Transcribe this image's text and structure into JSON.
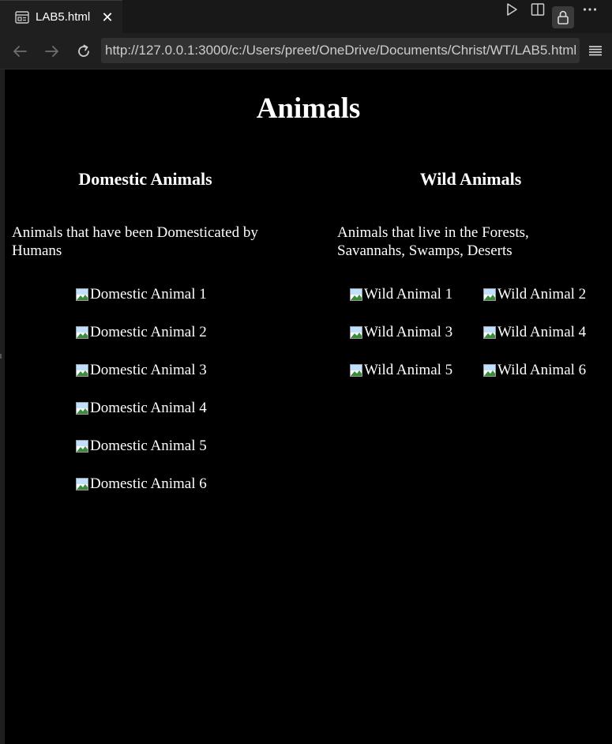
{
  "tab": {
    "title": "LAB5.html",
    "close_icon": "close-icon",
    "page_icon": "preview-icon"
  },
  "toolbar": {
    "icons": [
      "play-icon",
      "split-editor-icon",
      "lock-icon",
      "more-icon"
    ]
  },
  "nav": {
    "back_icon": "arrow-left-icon",
    "forward_icon": "arrow-right-icon",
    "reload_icon": "reload-icon",
    "url": "http://127.0.0.1:3000/c:/Users/preet/OneDrive/Documents/Christ/WT/LAB5.html",
    "menu_icon": "hamburger-icon"
  },
  "page": {
    "title": "Animals",
    "domestic": {
      "heading": "Domestic Animals",
      "description": "Animals that have been Domesticated by Humans",
      "images": [
        "Domestic Animal 1",
        "Domestic Animal 2",
        "Domestic Animal 3",
        "Domestic Animal 4",
        "Domestic Animal 5",
        "Domestic Animal 6"
      ]
    },
    "wild": {
      "heading": "Wild Animals",
      "description": "Animals that live in the Forests, Savannahs, Swamps, Deserts",
      "images": [
        "Wild Animal 1",
        "Wild Animal 2",
        "Wild Animal 3",
        "Wild Animal 4",
        "Wild Animal 5",
        "Wild Animal 6"
      ]
    }
  },
  "colors": {
    "page_bg": "#000000",
    "chrome_bg": "#1f1f1f",
    "url_bg": "#313131",
    "text": "#ffffff"
  }
}
